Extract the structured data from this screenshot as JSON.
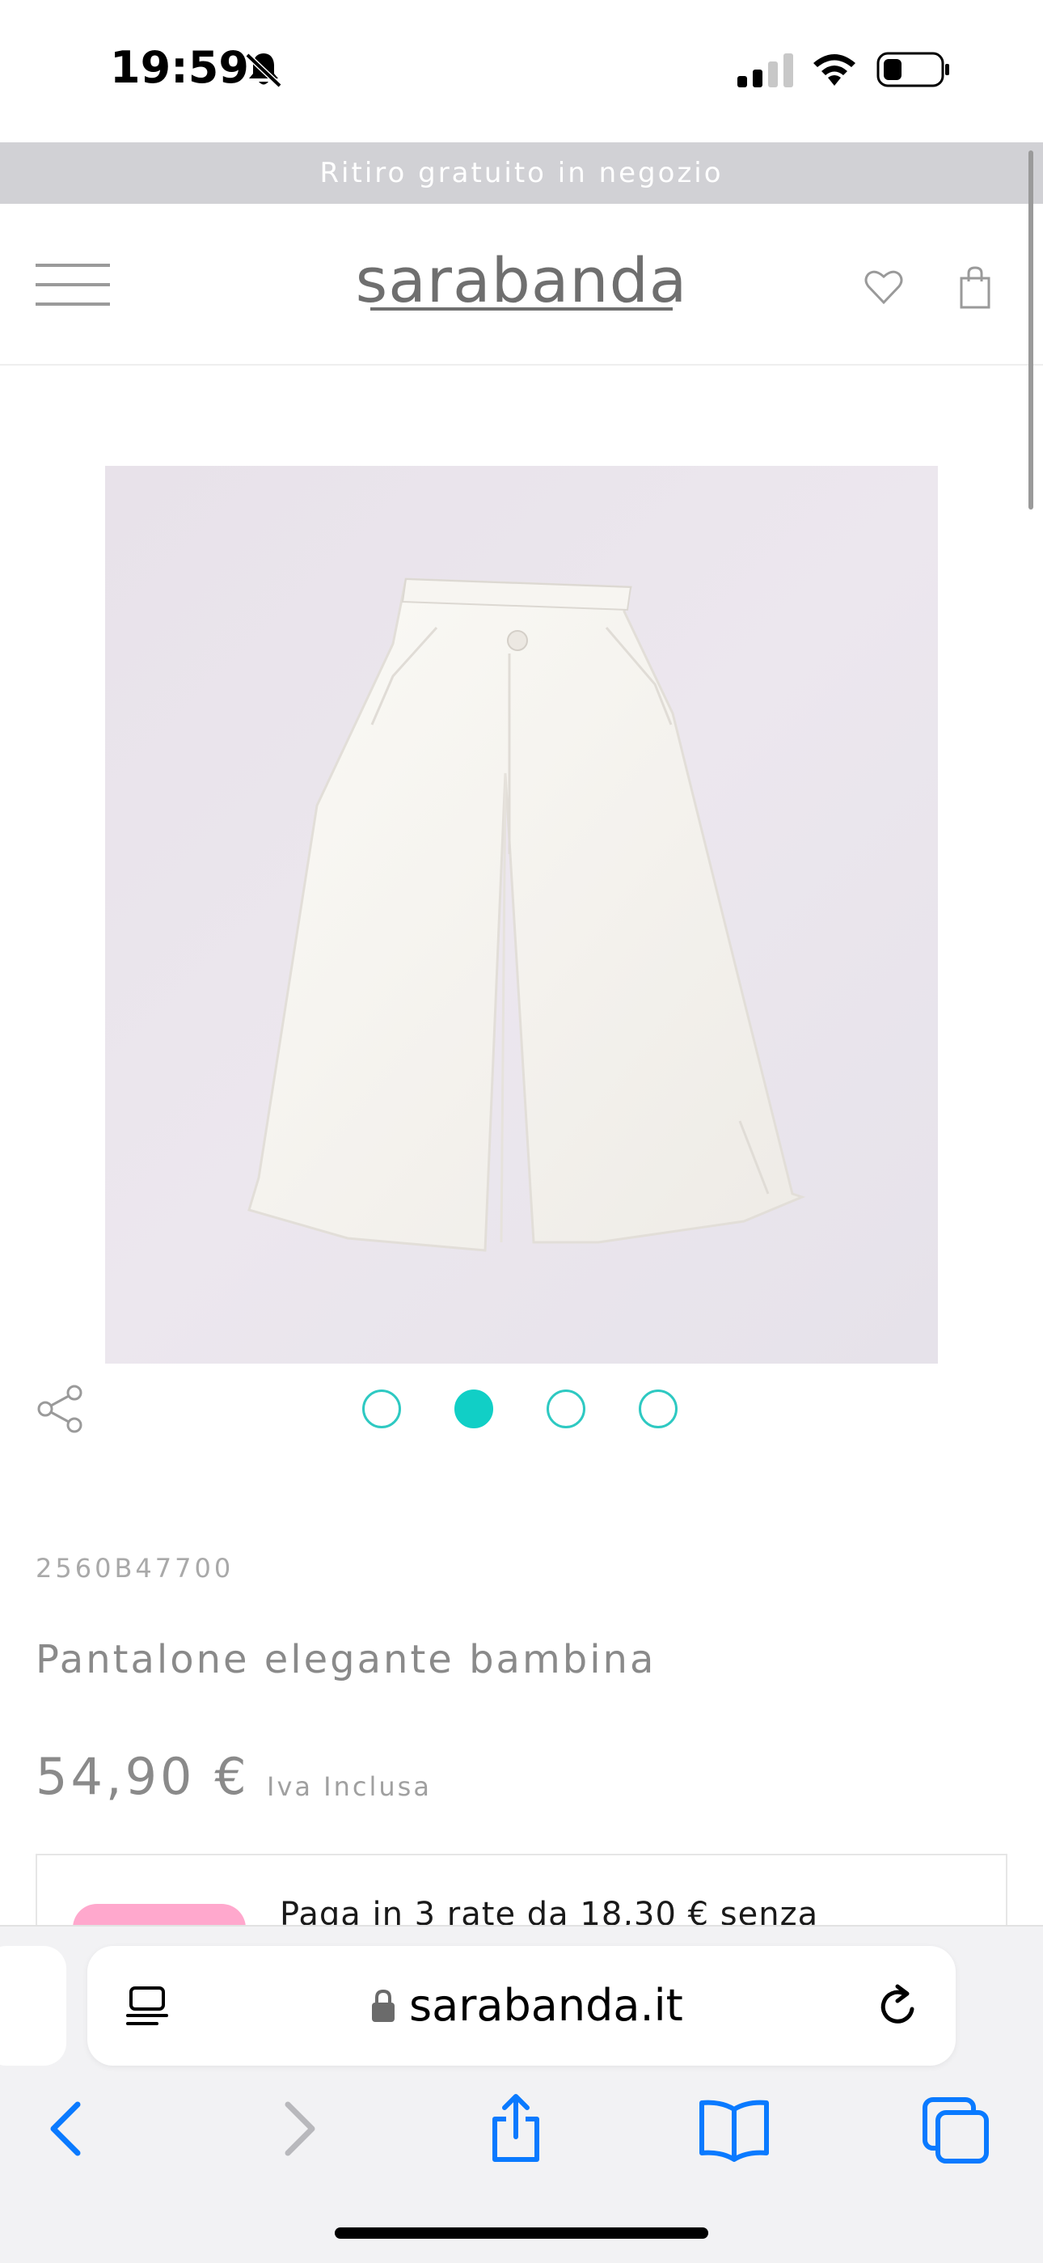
{
  "status": {
    "time": "19:59"
  },
  "promo": {
    "text": "Ritiro gratuito in negozio"
  },
  "header": {
    "logo": "sarabanda"
  },
  "gallery": {
    "dot_count": 4,
    "active_dot": 2
  },
  "product": {
    "sku": "2560B47700",
    "title": "Pantalone elegante bambina",
    "price": "54,90 €",
    "vat_note": "Iva Inclusa"
  },
  "payment": {
    "text": "Paga in 3 rate da 18,30 € senza"
  },
  "browser": {
    "url": "sarabanda.it"
  },
  "colors": {
    "accent": "#11cfc6",
    "promo_bg": "#d1d1d5",
    "klarna": "#ffa8cd",
    "ios_blue": "#0a7aff"
  }
}
